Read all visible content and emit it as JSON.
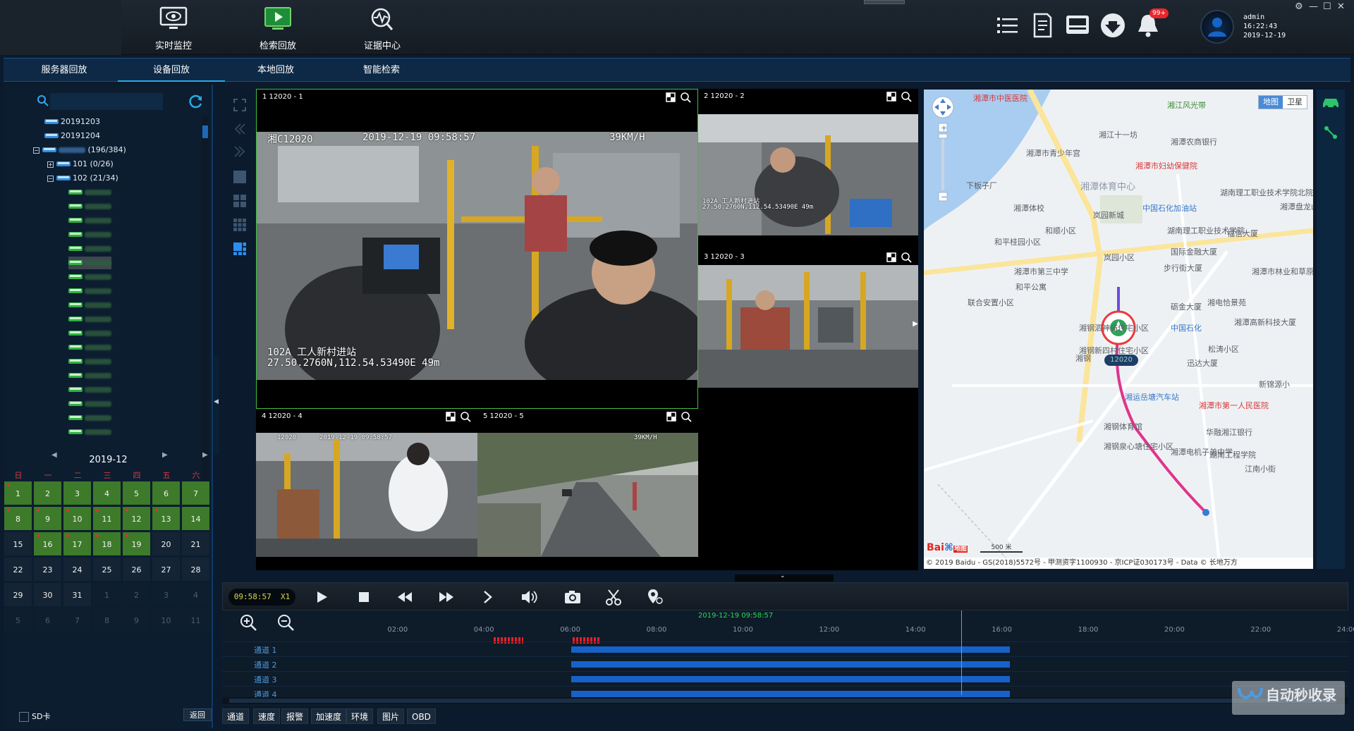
{
  "nav": {
    "items": [
      {
        "label": "实时监控",
        "icon": "monitor-eye-icon"
      },
      {
        "label": "检索回放",
        "icon": "playback-screen-icon"
      },
      {
        "label": "证据中心",
        "icon": "evidence-search-icon"
      }
    ],
    "active": "检索回放"
  },
  "toolbar_icons": [
    "list-icon",
    "document-icon",
    "inbox-icon",
    "download-icon",
    "bell-icon"
  ],
  "notifications_badge": "99+",
  "user": {
    "name": "admin",
    "time": "16:22:43",
    "date": "2019-12-19"
  },
  "subtabs": [
    "服务器回放",
    "设备回放",
    "本地回放",
    "智能检索"
  ],
  "active_subtab": "设备回放",
  "tree": {
    "dates": [
      "20191203",
      "20191204"
    ],
    "group": {
      "count": "(196/384)"
    },
    "routes": [
      {
        "name": "101",
        "count": "(0/26)"
      },
      {
        "name": "102",
        "count": "(21/34)"
      }
    ]
  },
  "calendar": {
    "month_label": "2019-12",
    "weekdays": [
      "日",
      "一",
      "二",
      "三",
      "四",
      "五",
      "六"
    ],
    "weeks": [
      [
        "1",
        "2",
        "3",
        "4",
        "5",
        "6",
        "7"
      ],
      [
        "8",
        "9",
        "10",
        "11",
        "12",
        "13",
        "14"
      ],
      [
        "15",
        "16",
        "17",
        "18",
        "19",
        "20",
        "21"
      ],
      [
        "22",
        "23",
        "24",
        "25",
        "26",
        "27",
        "28"
      ],
      [
        "29",
        "30",
        "31",
        "1",
        "2",
        "3",
        "4"
      ],
      [
        "5",
        "6",
        "7",
        "8",
        "9",
        "10",
        "11"
      ]
    ]
  },
  "sd_card_label": "SD卡",
  "back_label": "返回",
  "videos": [
    {
      "id": "1",
      "title": "1 12020 - 1",
      "plate": "湘C12020",
      "datetime": "2019-12-19 09:58:57",
      "speed": "39KM/H",
      "line": "102A 工人新村进站",
      "coords": "27.50.2760N,112.54.53490E 49m"
    },
    {
      "id": "2",
      "title": "2 12020 - 2",
      "line": "102A 工人新村进站",
      "coords": "27.50.2760N,112.54.53490E 49m"
    },
    {
      "id": "3",
      "title": "3 12020 - 3"
    },
    {
      "id": "4",
      "title": "4 12020 - 4",
      "plate": "12020",
      "datetime": "2019-12-19 09:58:57"
    },
    {
      "id": "5",
      "title": "5 12020 - 5",
      "speed": "39KM/H"
    }
  ],
  "map": {
    "type_tabs": [
      "地图",
      "卫星"
    ],
    "active_type": "地图",
    "labels": [
      "湘潭市中医医院",
      "湘江风光带",
      "湘江十一坊",
      "湘潭农商银行",
      "湘潭市青少年宫",
      "湘潭市妇幼保健院",
      "下板子厂",
      "湘潭体育中心",
      "湘潭体校",
      "岚园新城",
      "中国石化加油站",
      "湖南理工职业技术学院北院",
      "湘潭盘龙山庄大酒",
      "和顺小区",
      "湖南理工职业技术学院",
      "福信大厦",
      "和平桂园小区",
      "国际金融大厦",
      "岚园小区",
      "湘潭市第三中学",
      "步行街大厦",
      "湘潭市林业和草原局",
      "和平公寓",
      "联合安置小区",
      "砺金大厦",
      "湘电恰景苑",
      "湘潭高新科技大厦",
      "中国石化",
      "松涛小区",
      "湘钢泗神庙住宅小区",
      "湘钢新四村住宅小区",
      "湘钢",
      "迅达大厦",
      "新锦源小",
      "湘运岳塘汽车站",
      "湘潭市第一人民医院",
      "湘钢体育馆",
      "华融湘江银行",
      "湘钢泉心塘住宅小区",
      "湘潭电机子弟中学",
      "湖南工程学院",
      "江南小街"
    ],
    "vehicle_label": "12020",
    "scale": "500 米",
    "copyright": "© 2019 Baidu - GS(2018)5572号 - 甲测资字1100930 - 京ICP证030173号 - Data © 长地万方"
  },
  "playback": {
    "time": "09:58:57",
    "speed": "X1",
    "buttons": [
      "play-icon",
      "stop-icon",
      "rewind-icon",
      "fast-forward-icon",
      "next-frame-icon",
      "volume-icon",
      "camera-icon",
      "scissors-icon",
      "location-pin-icon"
    ]
  },
  "timeline": {
    "current": "2019-12-19 09:58:57",
    "hours": [
      "02:00",
      "04:00",
      "06:00",
      "08:00",
      "10:00",
      "12:00",
      "14:00",
      "16:00",
      "18:00",
      "20:00",
      "22:00",
      "24:00"
    ],
    "channels": [
      "通道 1",
      "通道 2",
      "通道 3",
      "通道 4"
    ],
    "record_start": "06:00",
    "record_end": "16:10"
  },
  "bottom_tabs": [
    "通道",
    "速度",
    "报警",
    "加速度",
    "环境",
    "图片",
    "OBD"
  ],
  "watermark": "自动秒收录"
}
